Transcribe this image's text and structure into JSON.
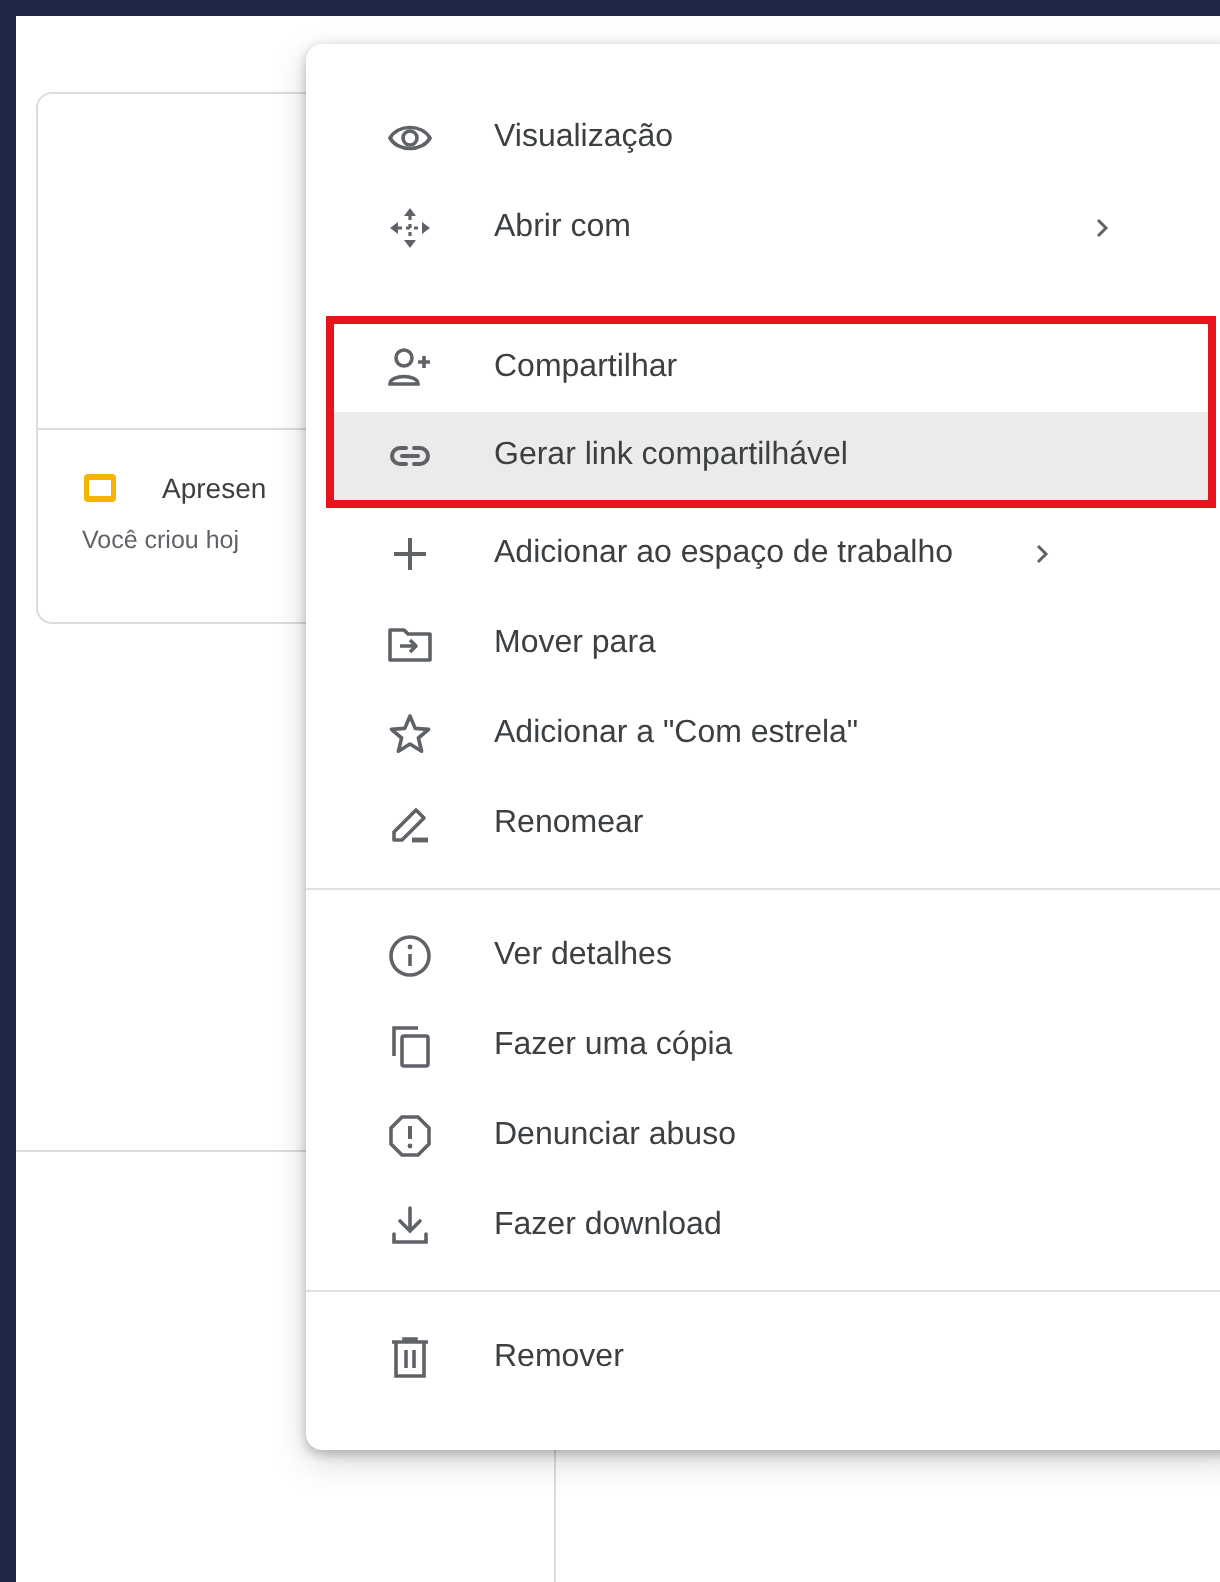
{
  "file_card": {
    "title": "Apresen",
    "subtitle": "Você criou hoj"
  },
  "context_menu": {
    "groups": [
      {
        "divided": false,
        "items": [
          {
            "label": "Visualização",
            "submenu": false,
            "selected": false,
            "annotated": false
          },
          {
            "label": "Abrir com",
            "submenu": true,
            "selected": false,
            "annotated": false
          }
        ]
      },
      {
        "divided": false,
        "items": [
          {
            "label": "Compartilhar",
            "submenu": false,
            "selected": false,
            "annotated": true
          },
          {
            "label": "Gerar link compartilhável",
            "submenu": false,
            "selected": true,
            "annotated": true
          },
          {
            "label": "Adicionar ao espaço de trabalho",
            "submenu": true,
            "selected": false,
            "annotated": false
          },
          {
            "label": "Mover para",
            "submenu": false,
            "selected": false,
            "annotated": false
          },
          {
            "label": "Adicionar a \"Com estrela\"",
            "submenu": false,
            "selected": false,
            "annotated": false
          },
          {
            "label": "Renomear",
            "submenu": false,
            "selected": false,
            "annotated": false
          }
        ]
      },
      {
        "divided": true,
        "items": [
          {
            "label": "Ver detalhes",
            "submenu": false,
            "selected": false,
            "annotated": false
          },
          {
            "label": "Fazer uma cópia",
            "submenu": false,
            "selected": false,
            "annotated": false
          },
          {
            "label": "Denunciar abuso",
            "submenu": false,
            "selected": false,
            "annotated": false
          },
          {
            "label": "Fazer download",
            "submenu": false,
            "selected": false,
            "annotated": false
          }
        ]
      },
      {
        "divided": true,
        "items": [
          {
            "label": "Remover",
            "submenu": false,
            "selected": false,
            "annotated": false
          }
        ]
      }
    ]
  }
}
